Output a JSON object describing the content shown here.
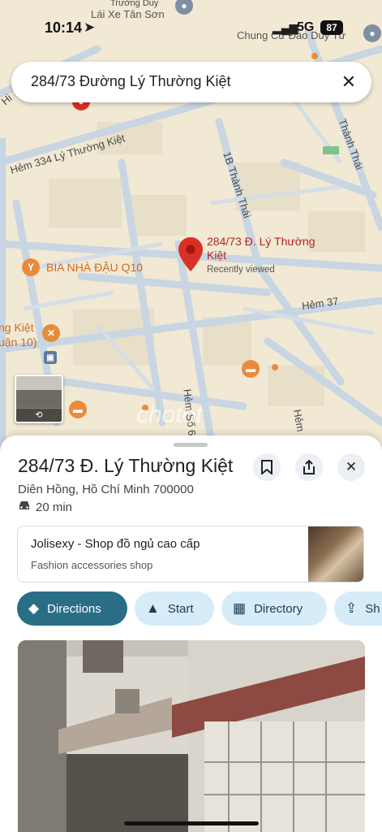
{
  "status_bar": {
    "time": "10:14",
    "network": "5G",
    "battery": "87"
  },
  "search": {
    "query": "284/73 Đường Lý Thường Kiệt",
    "clear_icon": "close-icon"
  },
  "map": {
    "streets": {
      "hem334": "Hẻm 334 Lý Thường Kiệt",
      "thanh_thai_1b": "1B Thành Thái",
      "thanh_thai": "Thành Thái",
      "hem37": "Hẻm 37",
      "hem_so6": "Hẻm Số 6",
      "hem": "Hẻm",
      "hi": "Hi",
      "truong_duy": "Trường Duy"
    },
    "pois": {
      "lai_xe": "Lái Xe Tân Sơn",
      "chung_cu": "Chung Cư Đào Duy Từ",
      "bia": "BIA NHÀ ĐẬU Q10",
      "ng_kiet": "ng Kiệt",
      "uan10": "uận 10)"
    },
    "pin": {
      "title": "284/73 Đ. Lý Thường Kiệt",
      "subtitle": "Recently viewed"
    },
    "watermark": "chotot",
    "street_view": {
      "icon": "rotate-360-icon"
    }
  },
  "place": {
    "title": "284/73 Đ. Lý Thường Kiệt",
    "address": "Diên Hồng, Hồ Chí Minh 700000",
    "drive_time": "20 min"
  },
  "nearby": {
    "name": "Jolisexy - Shop đồ ngủ cao cấp",
    "category": "Fashion accessories shop"
  },
  "actions": {
    "directions": "Directions",
    "start": "Start",
    "directory": "Directory",
    "share": "Sh"
  },
  "colors": {
    "accent": "#2a6e86",
    "chip": "#d6ecf8",
    "pin": "#d93025",
    "map_bg": "#f1e9d4"
  }
}
